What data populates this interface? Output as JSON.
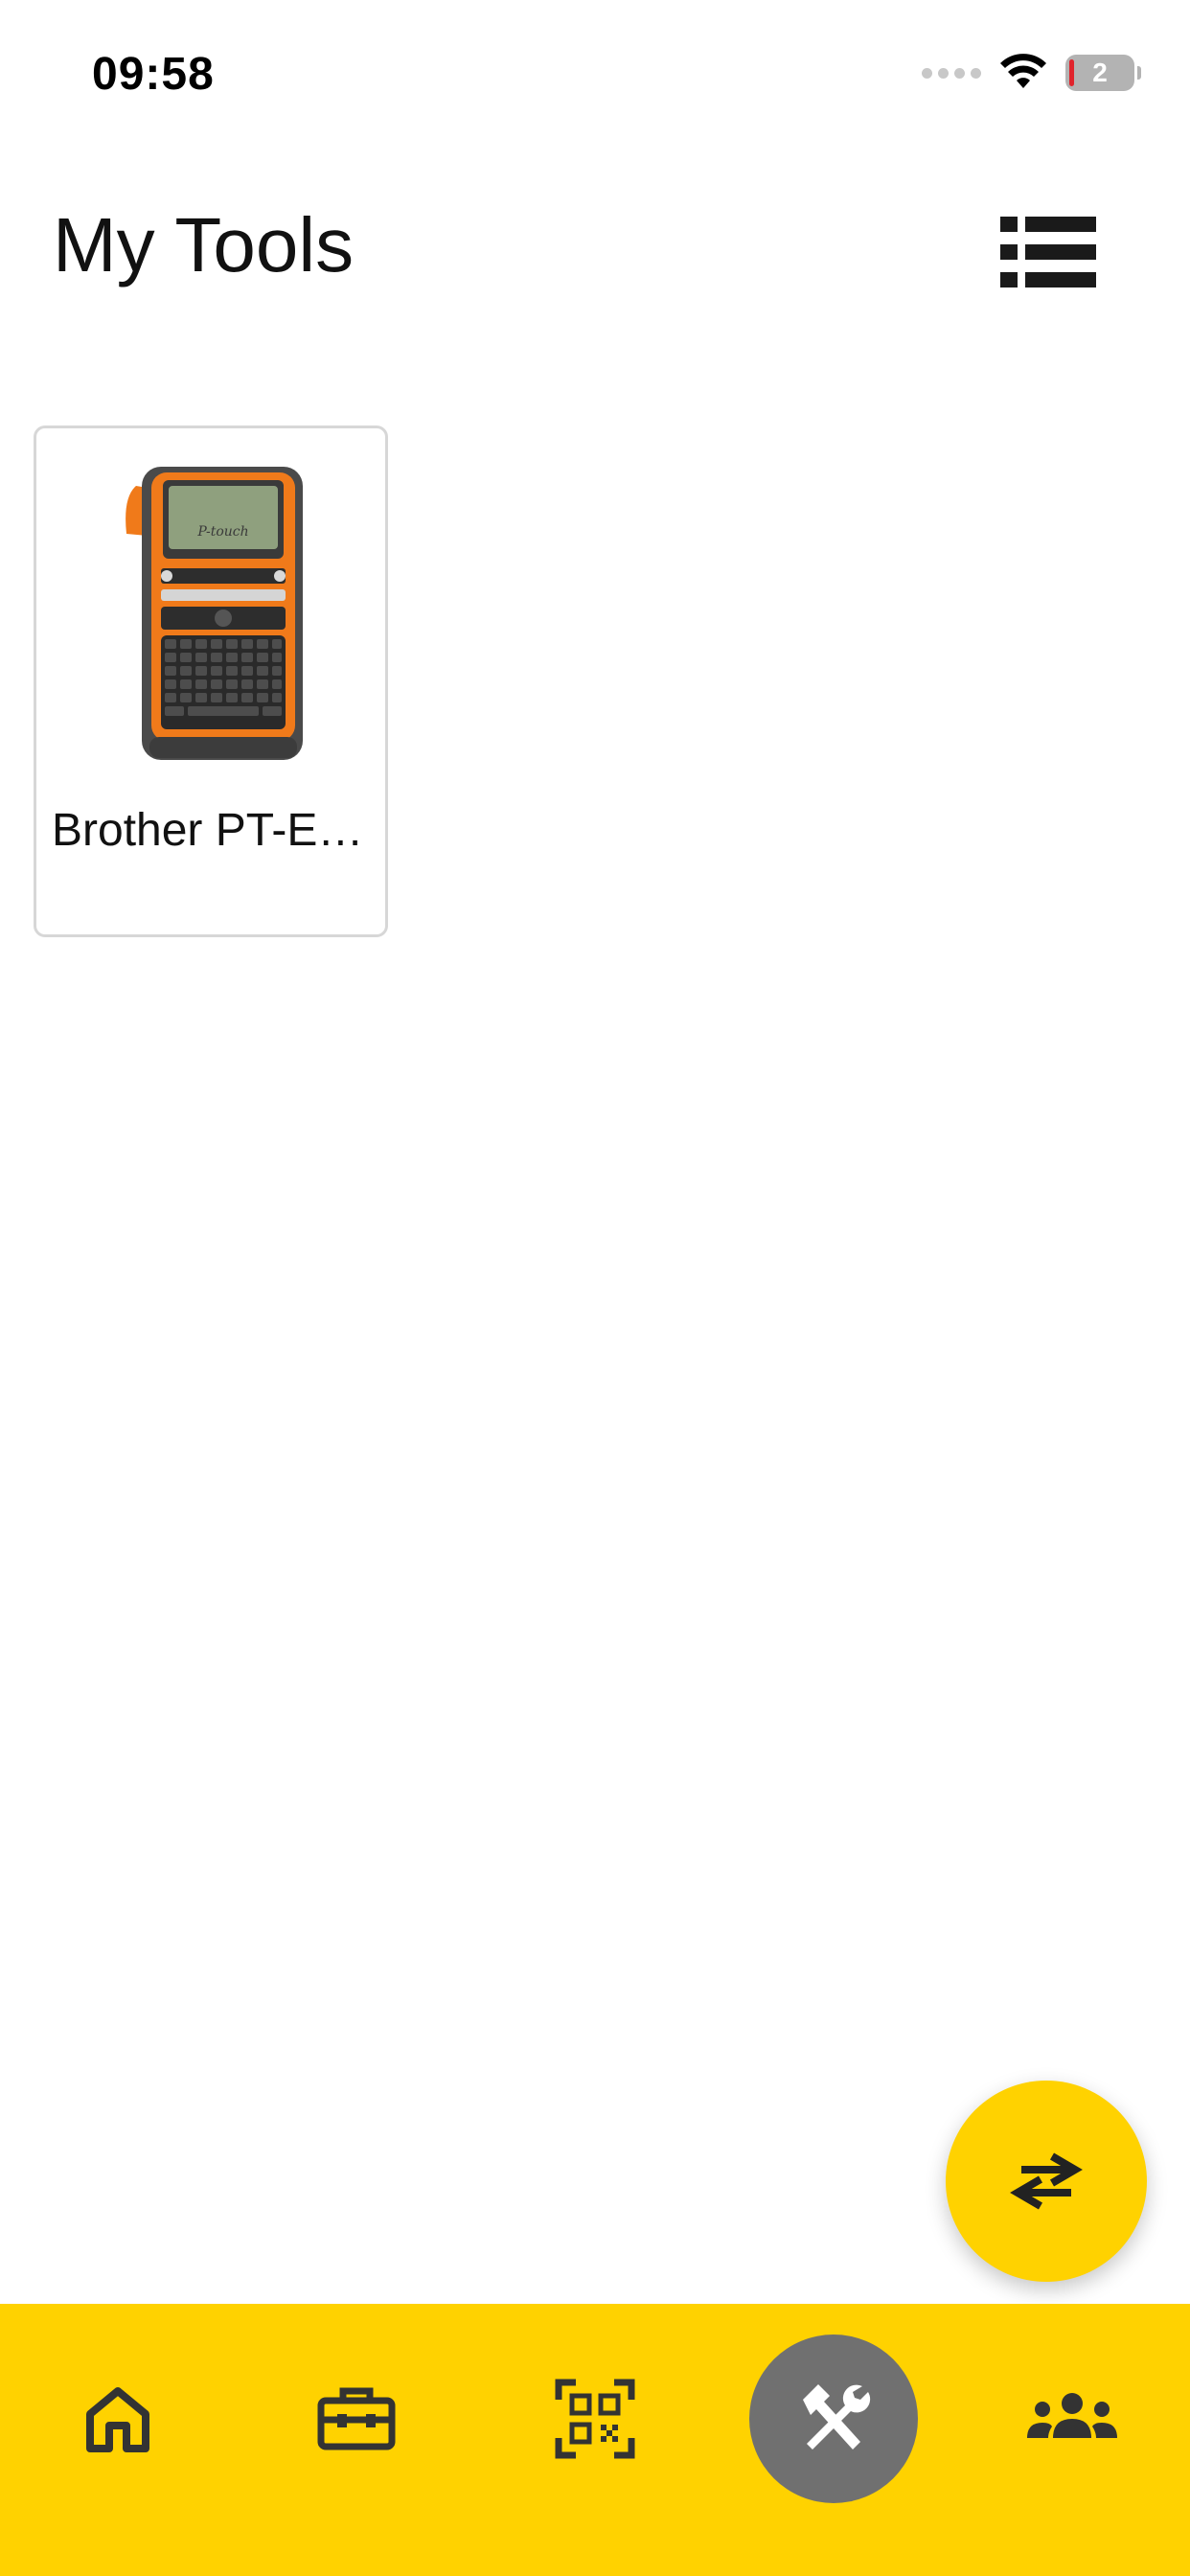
{
  "status_bar": {
    "time": "09:58",
    "battery_level": "2",
    "wifi_icon": "wifi-icon",
    "signal_icon": "cellular-signal-icon"
  },
  "header": {
    "title": "My Tools",
    "view_toggle_icon": "list-view-icon"
  },
  "tools": [
    {
      "name": "Brother PT-E…",
      "image_icon": "label-printer-image"
    }
  ],
  "fab": {
    "icon": "swap-arrows-icon"
  },
  "bottom_nav": {
    "items": [
      {
        "icon": "home-icon",
        "active": false
      },
      {
        "icon": "toolbox-icon",
        "active": false
      },
      {
        "icon": "qr-code-scan-icon",
        "active": false
      },
      {
        "icon": "tools-icon",
        "active": true
      },
      {
        "icon": "people-group-icon",
        "active": false
      }
    ]
  },
  "colors": {
    "accent": "#ffd200",
    "active_nav": "#707070",
    "icon_dark": "#333333",
    "card_border": "#d7d7d7"
  }
}
